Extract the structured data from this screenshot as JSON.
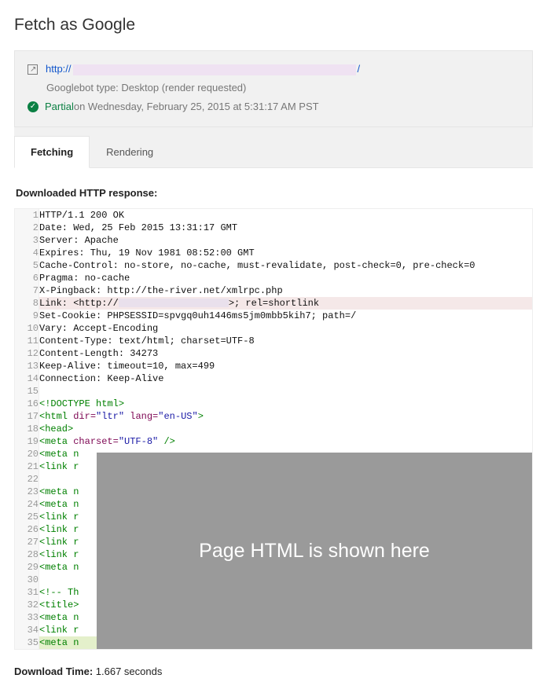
{
  "title": "Fetch as Google",
  "url": {
    "scheme": "http://",
    "trail": "/"
  },
  "googlebot_line": "Googlebot type: Desktop (render requested)",
  "status": {
    "label": "Partial",
    "rest": " on Wednesday, February 25, 2015 at 5:31:17 AM PST"
  },
  "tabs": {
    "fetching": "Fetching",
    "rendering": "Rendering"
  },
  "section_label": "Downloaded HTTP response:",
  "overlay_text": "Page HTML is shown here",
  "download_time": {
    "label": "Download Time:",
    "value": " 1.667 seconds"
  },
  "code": {
    "l1": "HTTP/1.1 200 OK",
    "l2": "Date: Wed, 25 Feb 2015 13:31:17 GMT",
    "l3": "Server: Apache",
    "l4": "Expires: Thu, 19 Nov 1981 08:52:00 GMT",
    "l5": "Cache-Control: no-store, no-cache, must-revalidate, post-check=0, pre-check=0",
    "l6": "Pragma: no-cache",
    "l7": "X-Pingback: http://the-river.net/xmlrpc.php",
    "l8a": "Link: <http://",
    "l8b": ">; rel=shortlink",
    "l9": "Set-Cookie: PHPSESSID=spvgq0uh1446ms5jm0mbb5kih7; path=/",
    "l10": "Vary: Accept-Encoding",
    "l11": "Content-Type: text/html; charset=UTF-8",
    "l12": "Content-Length: 34273",
    "l13": "Keep-Alive: timeout=10, max=499",
    "l14": "Connection: Keep-Alive",
    "l15": "",
    "l16": "<!DOCTYPE html>",
    "l17_open": "<html ",
    "l17_a1": "dir=",
    "l17_v1": "\"ltr\"",
    "l17_a2": " lang=",
    "l17_v2": "\"en-US\"",
    "l17_close": ">",
    "l18": "<head>",
    "l19_open": "<meta ",
    "l19_a1": "charset=",
    "l19_v1": "\"UTF-8\"",
    "l19_close": " />",
    "l20": "<meta n",
    "l21": "<link r",
    "l22": "",
    "l23": "<meta n",
    "l24": "<meta n",
    "l25": "<link r",
    "l26": "<link r",
    "l27": "<link r",
    "l28": "<link r",
    "l29": "<meta n",
    "l30": "",
    "l31": "<!-- Th",
    "l32": "<title>",
    "l33": "<meta n",
    "l34": "<link r",
    "l35": "<meta n"
  },
  "line_numbers": [
    "1",
    "2",
    "3",
    "4",
    "5",
    "6",
    "7",
    "8",
    "9",
    "10",
    "11",
    "12",
    "13",
    "14",
    "15",
    "16",
    "17",
    "18",
    "19",
    "20",
    "21",
    "22",
    "23",
    "24",
    "25",
    "26",
    "27",
    "28",
    "29",
    "30",
    "31",
    "32",
    "33",
    "34",
    "35"
  ]
}
